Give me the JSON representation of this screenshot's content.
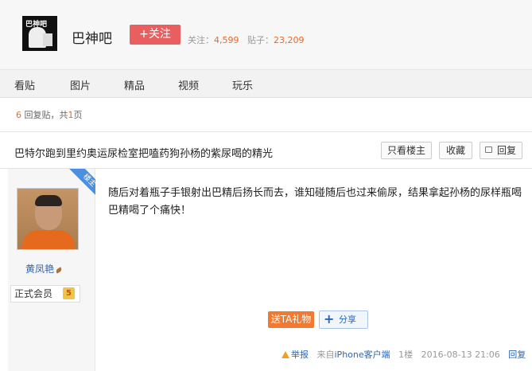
{
  "header": {
    "logo_text": "巴神吧",
    "bar_name": "巴神吧",
    "follow_label": "+关注",
    "follow_count_label": "关注：",
    "follow_count": "4,599",
    "post_count_label": "贴子：",
    "post_count": "23,209"
  },
  "nav": {
    "items": [
      "看贴",
      "图片",
      "精品",
      "视频",
      "玩乐"
    ]
  },
  "reply_summary": {
    "count": "6",
    "text": "回复贴，共",
    "pages": "1",
    "suffix": "页"
  },
  "thread": {
    "title": "巴特尔跑到里约奥运尿检室把嗑药狗孙杨的紫尿喝的精光",
    "only_author_label": "只看楼主",
    "collect_label": "收藏",
    "reply_label": "回复"
  },
  "post": {
    "badge": "楼主",
    "username": "黄凤艳",
    "member_label": "正式会员",
    "level": "5",
    "content": "随后对着瓶子手银射出巴精后扬长而去，谁知碰随后也过来偷尿，结果拿起孙杨的尿样瓶喝巴精喝了个痛快！",
    "gift_label": "送TA礼物",
    "share_label": "分享",
    "report_label": "举报",
    "from_prefix": "来自",
    "from_client": "iPhone客户端",
    "floor": "1楼",
    "date": "2016-08-13 21:06",
    "reply_label": "回复"
  },
  "colors": {
    "follow": "#e95f5f",
    "link": "#2d64b3",
    "accent": "#e46b27"
  }
}
